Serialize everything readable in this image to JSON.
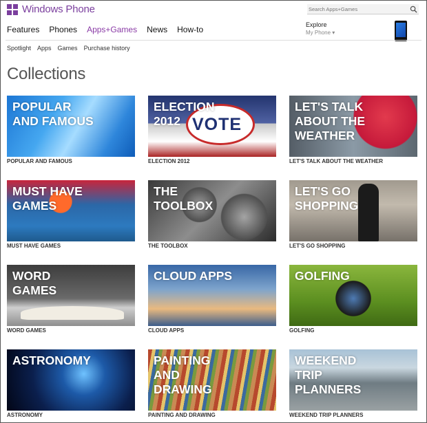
{
  "header": {
    "brand": "Windows Phone",
    "search_placeholder": "Search Apps+Games",
    "explore_label": "Explore",
    "explore_sub": "My Phone ▾"
  },
  "nav": {
    "items": [
      {
        "label": "Features",
        "active": false
      },
      {
        "label": "Phones",
        "active": false
      },
      {
        "label": "Apps+Games",
        "active": true
      },
      {
        "label": "News",
        "active": false
      },
      {
        "label": "How-to",
        "active": false
      }
    ]
  },
  "subnav": {
    "items": [
      {
        "label": "Spotlight"
      },
      {
        "label": "Apps"
      },
      {
        "label": "Games"
      },
      {
        "label": "Purchase history"
      }
    ]
  },
  "page": {
    "heading": "Collections"
  },
  "colors": {
    "brand_purple": "#7b3f9e",
    "active_nav": "#8a3ba6"
  },
  "collections": [
    {
      "overlay": "POPULAR\nAND FAMOUS",
      "caption": "POPULAR AND FAMOUS",
      "art": "popular"
    },
    {
      "overlay": "ELECTION\n2012",
      "caption": "ELECTION 2012",
      "art": "election",
      "badge_text": "VOTE"
    },
    {
      "overlay": "LET'S TALK\nABOUT THE\nWEATHER",
      "caption": "LET'S TALK ABOUT THE WEATHER",
      "art": "weather"
    },
    {
      "overlay": "MUST HAVE\nGAMES",
      "caption": "MUST HAVE GAMES",
      "art": "games"
    },
    {
      "overlay": "THE\nTOOLBOX",
      "caption": "THE TOOLBOX",
      "art": "toolbox"
    },
    {
      "overlay": "LET'S GO\nSHOPPING",
      "caption": "LET'S GO SHOPPING",
      "art": "shopping"
    },
    {
      "overlay": "WORD\nGAMES",
      "caption": "WORD GAMES",
      "art": "word"
    },
    {
      "overlay": "CLOUD APPS",
      "caption": "CLOUD APPS",
      "art": "cloud"
    },
    {
      "overlay": "GOLFING",
      "caption": "GOLFING",
      "art": "golf"
    },
    {
      "overlay": "ASTRONOMY",
      "caption": "ASTRONOMY",
      "art": "astro"
    },
    {
      "overlay": "PAINTING\nAND\nDRAWING",
      "caption": "PAINTING AND DRAWING",
      "art": "painting"
    },
    {
      "overlay": "WEEKEND\nTRIP\nPLANNERS",
      "caption": "WEEKEND TRIP PLANNERS",
      "art": "weekend"
    }
  ]
}
